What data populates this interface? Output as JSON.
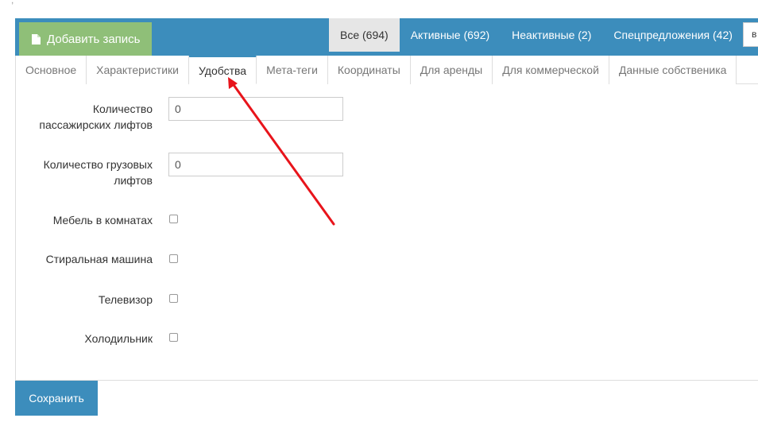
{
  "toolbar": {
    "add_label": "Добавить запись",
    "filters": [
      {
        "label": "Все (694)",
        "active": true
      },
      {
        "label": "Активные (692)",
        "active": false
      },
      {
        "label": "Неактивные (2)",
        "active": false
      },
      {
        "label": "Спецпредложения (42)",
        "active": false
      }
    ],
    "cut_text": "в"
  },
  "tabs": [
    {
      "label": "Основное",
      "active": false
    },
    {
      "label": "Характеристики",
      "active": false
    },
    {
      "label": "Удобства",
      "active": true
    },
    {
      "label": "Мета-теги",
      "active": false
    },
    {
      "label": "Координаты",
      "active": false
    },
    {
      "label": "Для аренды",
      "active": false
    },
    {
      "label": "Для коммерческой",
      "active": false
    },
    {
      "label": "Данные собственика",
      "active": false
    }
  ],
  "form": {
    "passenger_lifts_label_1": "Количество",
    "passenger_lifts_label_2": "пассажирских лифтов",
    "passenger_lifts_value": "0",
    "freight_lifts_label_1": "Количество грузовых",
    "freight_lifts_label_2": "лифтов",
    "freight_lifts_value": "0",
    "furniture_label": "Мебель в комнатах",
    "washer_label": "Стиральная машина",
    "tv_label": "Телевизор",
    "fridge_label": "Холодильник"
  },
  "footer": {
    "save_label": "Сохранить"
  },
  "colors": {
    "toolbar_bg": "#3c8dbc",
    "add_button_bg": "#8fbf78",
    "annotation_arrow": "#e8141b"
  },
  "icons": {
    "add": "file-icon"
  }
}
